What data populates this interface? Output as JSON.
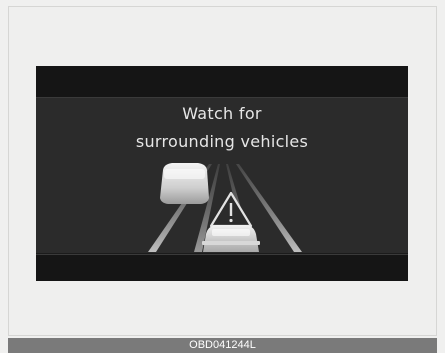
{
  "display": {
    "message_line1": "Watch for",
    "message_line2": "surrounding vehicles"
  },
  "figure": {
    "code": "OBD041244L"
  },
  "icons": [
    "warning-triangle-icon",
    "own-vehicle-icon",
    "side-vehicle-icon"
  ]
}
